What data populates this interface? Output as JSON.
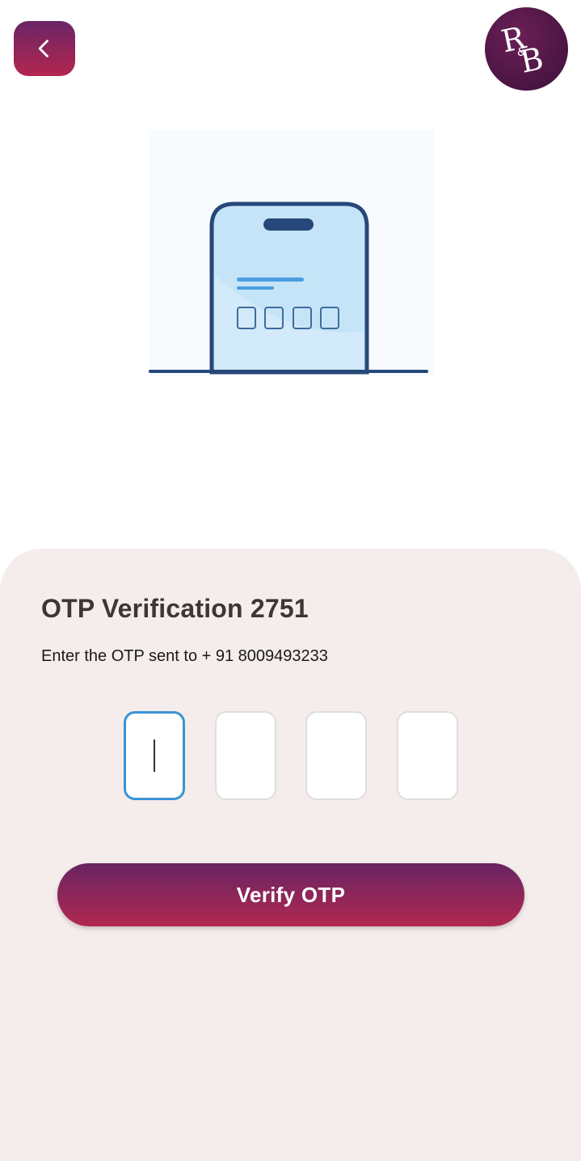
{
  "header": {
    "back_icon": "chevron-left-icon",
    "logo_text": "R&B"
  },
  "illustration": {
    "name": "phone-otp-illustration",
    "code_squares": 4
  },
  "otp": {
    "title": "OTP Verification 2751",
    "subtitle": "Enter the OTP sent to + 91 8009493233",
    "digits": [
      "",
      "",
      "",
      ""
    ],
    "active_index": 0,
    "verify_label": "Verify OTP"
  },
  "colors": {
    "accent_top": "#692463",
    "accent_bottom": "#b02850",
    "panel_bg": "#f5ecec",
    "active_field_border": "#3b93d6"
  }
}
